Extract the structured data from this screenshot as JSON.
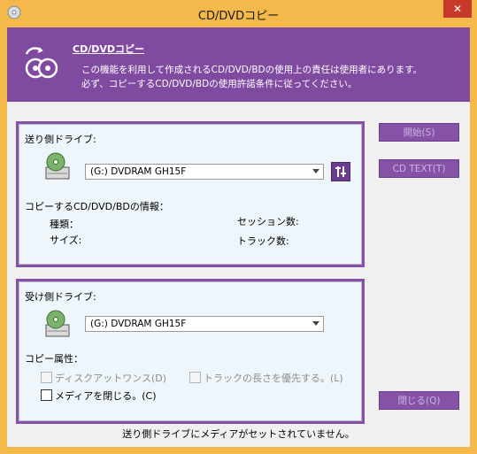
{
  "window": {
    "title": "CD/DVDコピー"
  },
  "banner": {
    "title": "CD/DVDコピー",
    "description_line1": "この機能を利用して作成されるCD/DVD/BDの使用上の責任は使用者にあります。",
    "description_line2": "必ず、コピーするCD/DVD/BDの使用許諾条件に従ってください。"
  },
  "source": {
    "label": "送り側ドライブ:",
    "selected_drive": "(G:) DVDRAM GH15F",
    "info_heading": "コピーするCD/DVD/BDの情報：",
    "type_label": "種類：",
    "size_label": "サイズ:",
    "sessions_label": "セッション数:",
    "tracks_label": "トラック数:"
  },
  "target": {
    "label": "受け側ドライブ:",
    "selected_drive": "(G:) DVDRAM GH15F",
    "attr_label": "コピー属性：",
    "disc_at_once": "ディスクアットワンス(D)",
    "prefer_track_length": "トラックの長さを優先する。(L)",
    "close_media": "メディアを閉じる。(C)"
  },
  "buttons": {
    "start": "開始(S)",
    "cd_text": "CD TEXT(T)",
    "close": "閉じる(Q)"
  },
  "status": "送り側ドライブにメディアがセットされていません。",
  "colors": {
    "accent": "#7f4aa0",
    "frame": "#f4b94a",
    "panel": "#eef6fb"
  }
}
